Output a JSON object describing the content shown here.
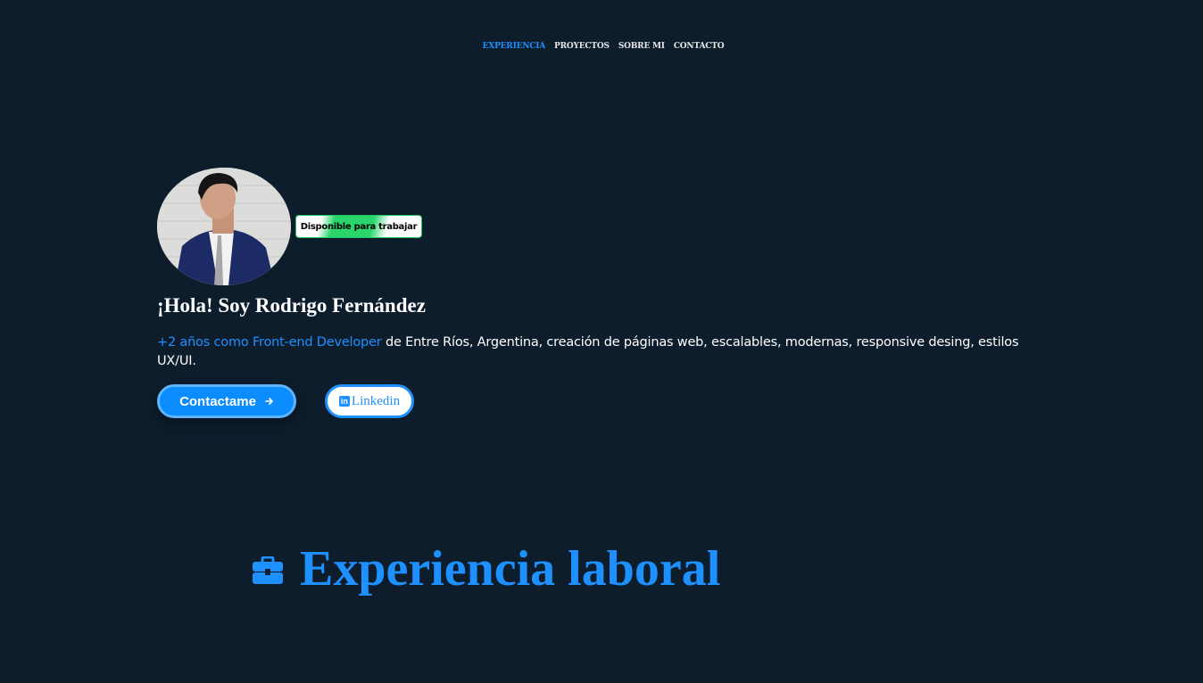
{
  "nav": {
    "items": [
      {
        "label": "EXPERIENCIA",
        "active": true
      },
      {
        "label": "PROYECTOS",
        "active": false
      },
      {
        "label": "SOBRE MI",
        "active": false
      },
      {
        "label": "CONTACTO",
        "active": false
      }
    ]
  },
  "hero": {
    "badge": "Disponible para trabajar",
    "greeting": "¡Hola! Soy Rodrigo Fernández",
    "highlight": "+2 años como Front-end Developer",
    "description": " de Entre Ríos, Argentina, creación de páginas web, escalables, modernas, responsive desing, estilos UX/UI.",
    "contact_button": "Contactame",
    "contact_icon": "arrow-right-icon",
    "linkedin_button": "Linkedin",
    "linkedin_icon": "linkedin-icon"
  },
  "experience": {
    "title": "Experiencia laboral",
    "icon": "briefcase-icon"
  },
  "colors": {
    "background": "#0d1d2c",
    "accent": "#1e90ff",
    "badge_green": "#22c55e"
  }
}
